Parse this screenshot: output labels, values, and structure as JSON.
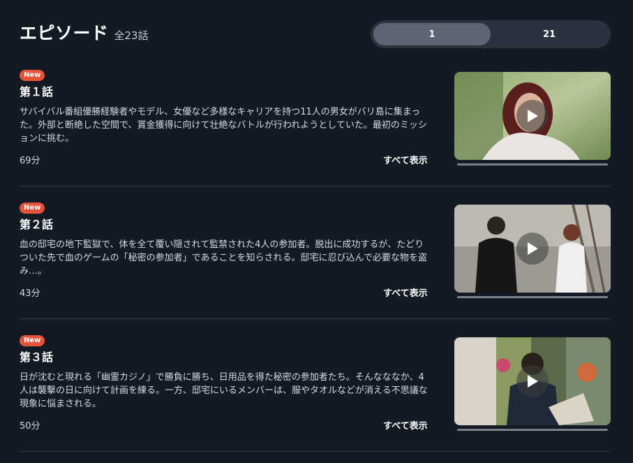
{
  "header": {
    "title": "エピソード",
    "count": "全23話"
  },
  "pager": {
    "pages": [
      "1",
      "21"
    ],
    "active": "1"
  },
  "episodes": [
    {
      "badge": "New",
      "title": "第１話",
      "description": "サバイバル番組優勝経験者やモデル、女優など多様なキャリアを持つ11人の男女がバリ島に集まった。外部と断絶した空間で、賞金獲得に向けて壮絶なバトルが行われようとしていた。最初のミッションに挑む。",
      "duration": "69分",
      "show_all": "すべて表示",
      "thumbnail": "thumbnail-episode-1",
      "progress": 0
    },
    {
      "badge": "New",
      "title": "第２話",
      "description": "血の邸宅の地下監獄で、体を全て覆い隠されて監禁された4人の参加者。脱出に成功するが、たどりついた先で血のゲームの「秘密の参加者」であることを知らされる。邸宅に忍び込んで必要な物を盗み…。",
      "duration": "43分",
      "show_all": "すべて表示",
      "thumbnail": "thumbnail-episode-2",
      "progress": 0
    },
    {
      "badge": "New",
      "title": "第３話",
      "description": "日が沈むと現れる「幽霊カジノ」で勝負に勝ち、日用品を得た秘密の参加者たち。そんなななか、4人は襲撃の日に向けて計画を練る。一方、邸宅にいるメンバーは、服やタオルなどが消える不思議な現象に悩まされる。",
      "duration": "50分",
      "show_all": "すべて表示",
      "thumbnail": "thumbnail-episode-3",
      "progress": 0
    }
  ],
  "colors": {
    "background": "#131a24",
    "badge": "#e5533a",
    "pager_bg": "#2a3240",
    "pager_active": "#5d6573"
  }
}
